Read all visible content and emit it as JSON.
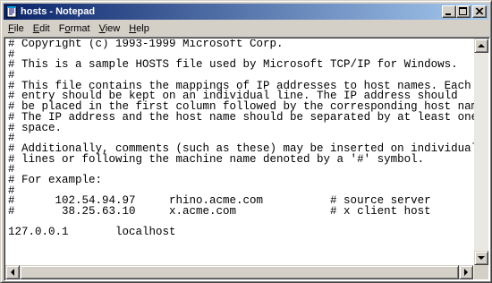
{
  "window": {
    "title": "hosts - Notepad",
    "icon": "notepad-icon"
  },
  "caption_buttons": [
    "minimize-icon",
    "maximize-icon",
    "close-icon"
  ],
  "menu": [
    {
      "label": "File",
      "accel": "F",
      "rest": "ile"
    },
    {
      "label": "Edit",
      "accel": "E",
      "rest": "dit"
    },
    {
      "label": "Format",
      "accel": "o",
      "pre": "F",
      "rest": "rmat"
    },
    {
      "label": "View",
      "accel": "V",
      "rest": "iew"
    },
    {
      "label": "Help",
      "accel": "H",
      "rest": "elp"
    }
  ],
  "document": {
    "lines": [
      "# Copyright (c) 1993-1999 Microsoft Corp.",
      "#",
      "# This is a sample HOSTS file used by Microsoft TCP/IP for Windows.",
      "#",
      "# This file contains the mappings of IP addresses to host names. Each",
      "# entry should be kept on an individual line. The IP address should",
      "# be placed in the first column followed by the corresponding host name.",
      "# The IP address and the host name should be separated by at least one",
      "# space.",
      "#",
      "# Additionally, comments (such as these) may be inserted on individual",
      "# lines or following the machine name denoted by a '#' symbol.",
      "#",
      "# For example:",
      "#",
      "#      102.54.94.97     rhino.acme.com          # source server",
      "#       38.25.63.10     x.acme.com              # x client host",
      "",
      "127.0.0.1       localhost",
      ""
    ]
  },
  "colors": {
    "title_gradient_start": "#0a246a",
    "title_gradient_end": "#a6caf0",
    "face": "#d4d0c8"
  }
}
